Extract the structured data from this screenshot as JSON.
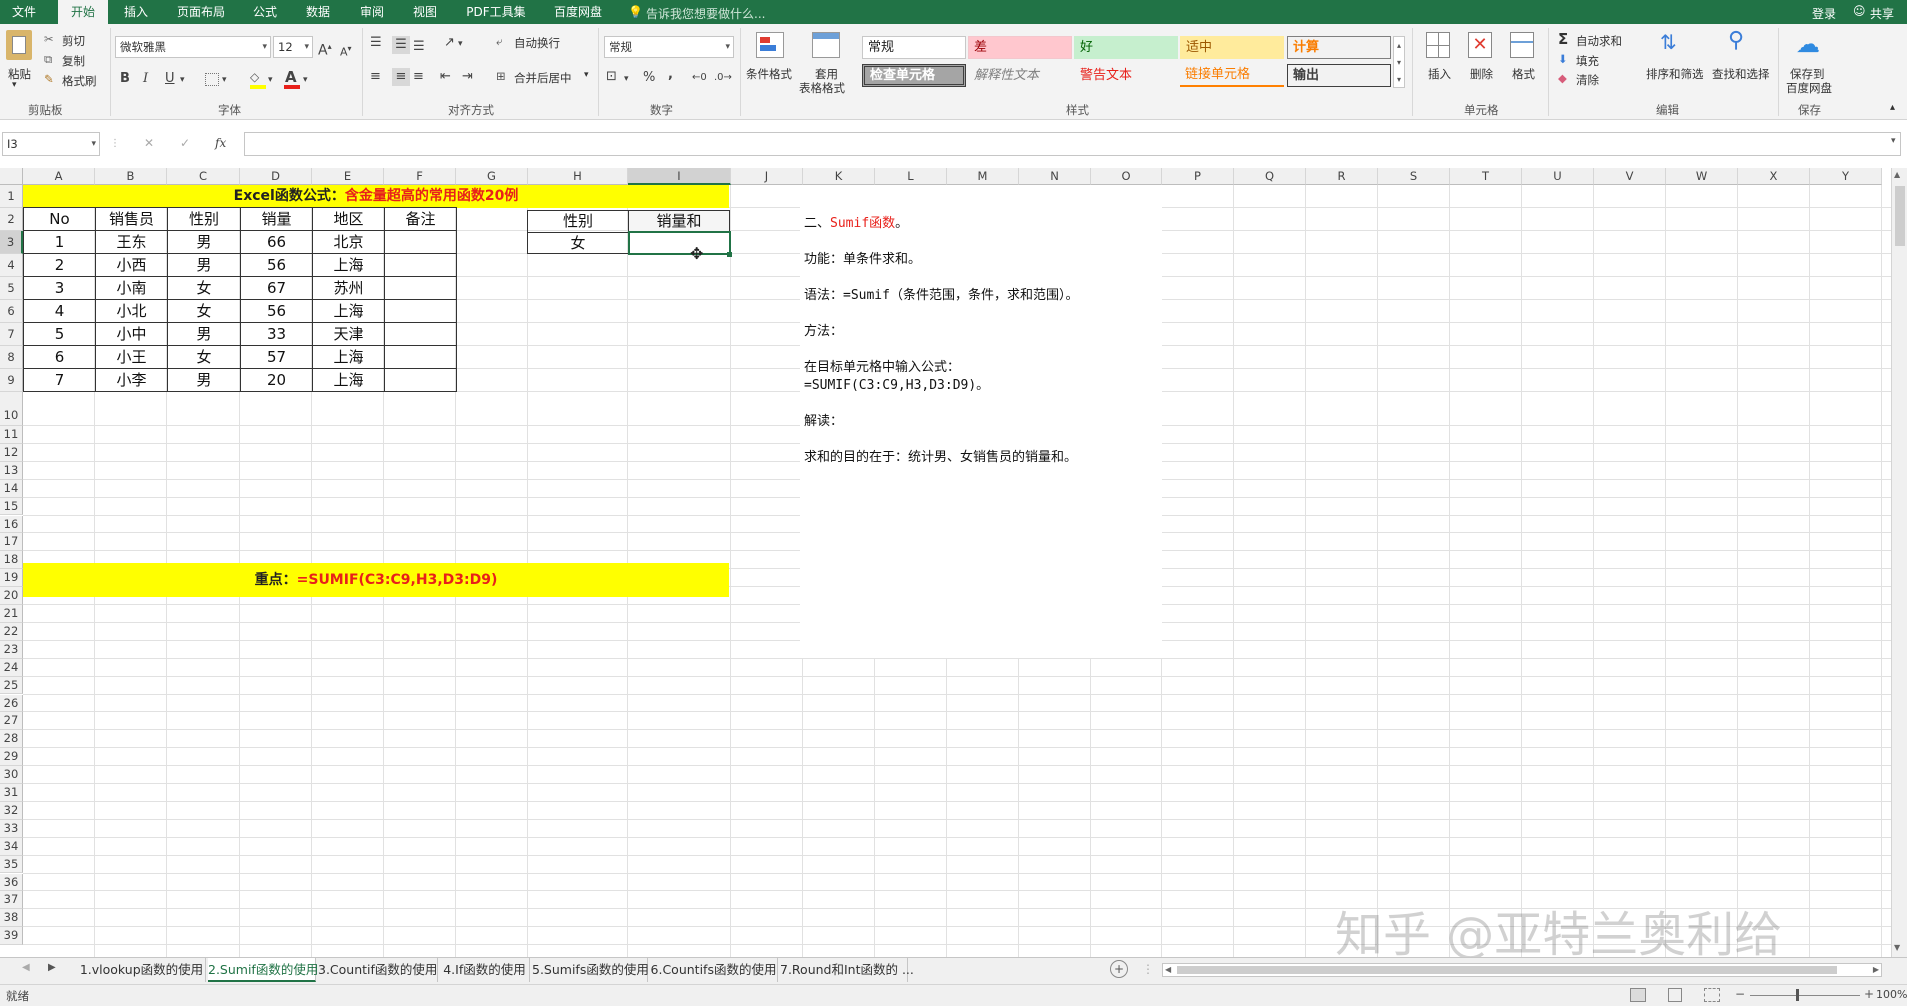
{
  "menubar": {
    "tabs": [
      "文件",
      "开始",
      "插入",
      "页面布局",
      "公式",
      "数据",
      "审阅",
      "视图",
      "PDF工具集",
      "百度网盘"
    ],
    "search_placeholder": "告诉我您想要做什么...",
    "login": "登录",
    "share": "共享",
    "accent": "#217346"
  },
  "ribbon": {
    "clipboard": {
      "paste": "粘贴",
      "cut": "剪切",
      "copy": "复制",
      "format_painter": "格式刷",
      "group": "剪贴板"
    },
    "font": {
      "name": "微软雅黑",
      "size": "12",
      "bold": "B",
      "italic": "I",
      "underline": "U",
      "font_color_glyph": "A",
      "grow": "A",
      "shrink": "A",
      "group": "字体"
    },
    "alignment": {
      "wrap": "自动换行",
      "merge": "合并后居中",
      "group": "对齐方式"
    },
    "number": {
      "format": "常规",
      "percent": "%",
      "comma": ",",
      "group": "数字"
    },
    "styles": {
      "conditional": "条件格式",
      "table_format_1": "套用",
      "table_format_2": "表格格式",
      "normal": "常规",
      "bad": "差",
      "good": "好",
      "neutral": "适中",
      "calculation": "计算",
      "check_cell": "检查单元格",
      "explanatory": "解释性文本",
      "warning": "警告文本",
      "linked": "链接单元格",
      "output": "输出",
      "group": "样式"
    },
    "cells": {
      "insert": "插入",
      "delete": "删除",
      "format": "格式",
      "group": "单元格"
    },
    "editing": {
      "autosum": "自动求和",
      "fill": "填充",
      "clear": "清除",
      "sort": "排序和筛选",
      "find": "查找和选择",
      "group": "编辑"
    },
    "save": {
      "line1": "保存到",
      "line2": "百度网盘",
      "group": "保存"
    }
  },
  "formula_bar": {
    "name_box": "I3",
    "fx": "fx",
    "cancel": "✕",
    "enter": "✓",
    "value": ""
  },
  "columns": [
    "A",
    "B",
    "C",
    "D",
    "E",
    "F",
    "G",
    "H",
    "I",
    "J",
    "K",
    "L",
    "M",
    "N",
    "O",
    "P",
    "Q",
    "R",
    "S",
    "T",
    "U",
    "V",
    "W",
    "X",
    "Y"
  ],
  "rows": [
    "1",
    "2",
    "3",
    "4",
    "5",
    "6",
    "7",
    "8",
    "9",
    "10",
    "11",
    "12",
    "13",
    "14",
    "15",
    "16",
    "17",
    "18",
    "19",
    "20",
    "21",
    "22",
    "23",
    "24",
    "25",
    "26",
    "27",
    "28",
    "29",
    "30",
    "31",
    "32",
    "33",
    "34",
    "35",
    "36",
    "37",
    "38",
    "39"
  ],
  "sheet": {
    "title_prefix": "Excel函数公式：",
    "title_highlight": "含金量超高的常用函数20例",
    "headers": [
      "No",
      "销售员",
      "性别",
      "销量",
      "地区",
      "备注"
    ],
    "data": [
      [
        "1",
        "王东",
        "男",
        "66",
        "北京",
        ""
      ],
      [
        "2",
        "小西",
        "男",
        "56",
        "上海",
        ""
      ],
      [
        "3",
        "小南",
        "女",
        "67",
        "苏州",
        ""
      ],
      [
        "4",
        "小北",
        "女",
        "56",
        "上海",
        ""
      ],
      [
        "5",
        "小中",
        "男",
        "33",
        "天津",
        ""
      ],
      [
        "6",
        "小王",
        "女",
        "57",
        "上海",
        ""
      ],
      [
        "7",
        "小李",
        "男",
        "20",
        "上海",
        ""
      ]
    ],
    "key_prefix": "重点：",
    "key_formula": "=SUMIF(C3:C9,H3,D3:D9)",
    "side_headers": [
      "性别",
      "销量和"
    ],
    "side_value": "女",
    "yellow": "#ffff00",
    "red": "#e8201a"
  },
  "notes": {
    "title_prefix": "二、",
    "title_func": "Sumif函数",
    "title_suffix": "。",
    "line1": "功能：单条件求和。",
    "line2": "语法：=Sumif（条件范围，条件，求和范围）。",
    "line3": "方法：",
    "line4": "在目标单元格中输入公式：",
    "line5": "=SUMIF(C3:C9,H3,D3:D9)。",
    "line6": "解读：",
    "line7": "求和的目的在于：统计男、女销售员的销量和。"
  },
  "sheet_tabs": [
    "1.vlookup函数的使用",
    "2.Sumif函数的使用",
    "3.Countif函数的使用",
    "4.If函数的使用",
    "5.Sumifs函数的使用",
    "6.Countifs函数的使用",
    "7.Round和Int函数的 ..."
  ],
  "status": {
    "ready": "就绪",
    "zoom": "100%"
  },
  "watermark": "知乎 @亚特兰奥利给"
}
